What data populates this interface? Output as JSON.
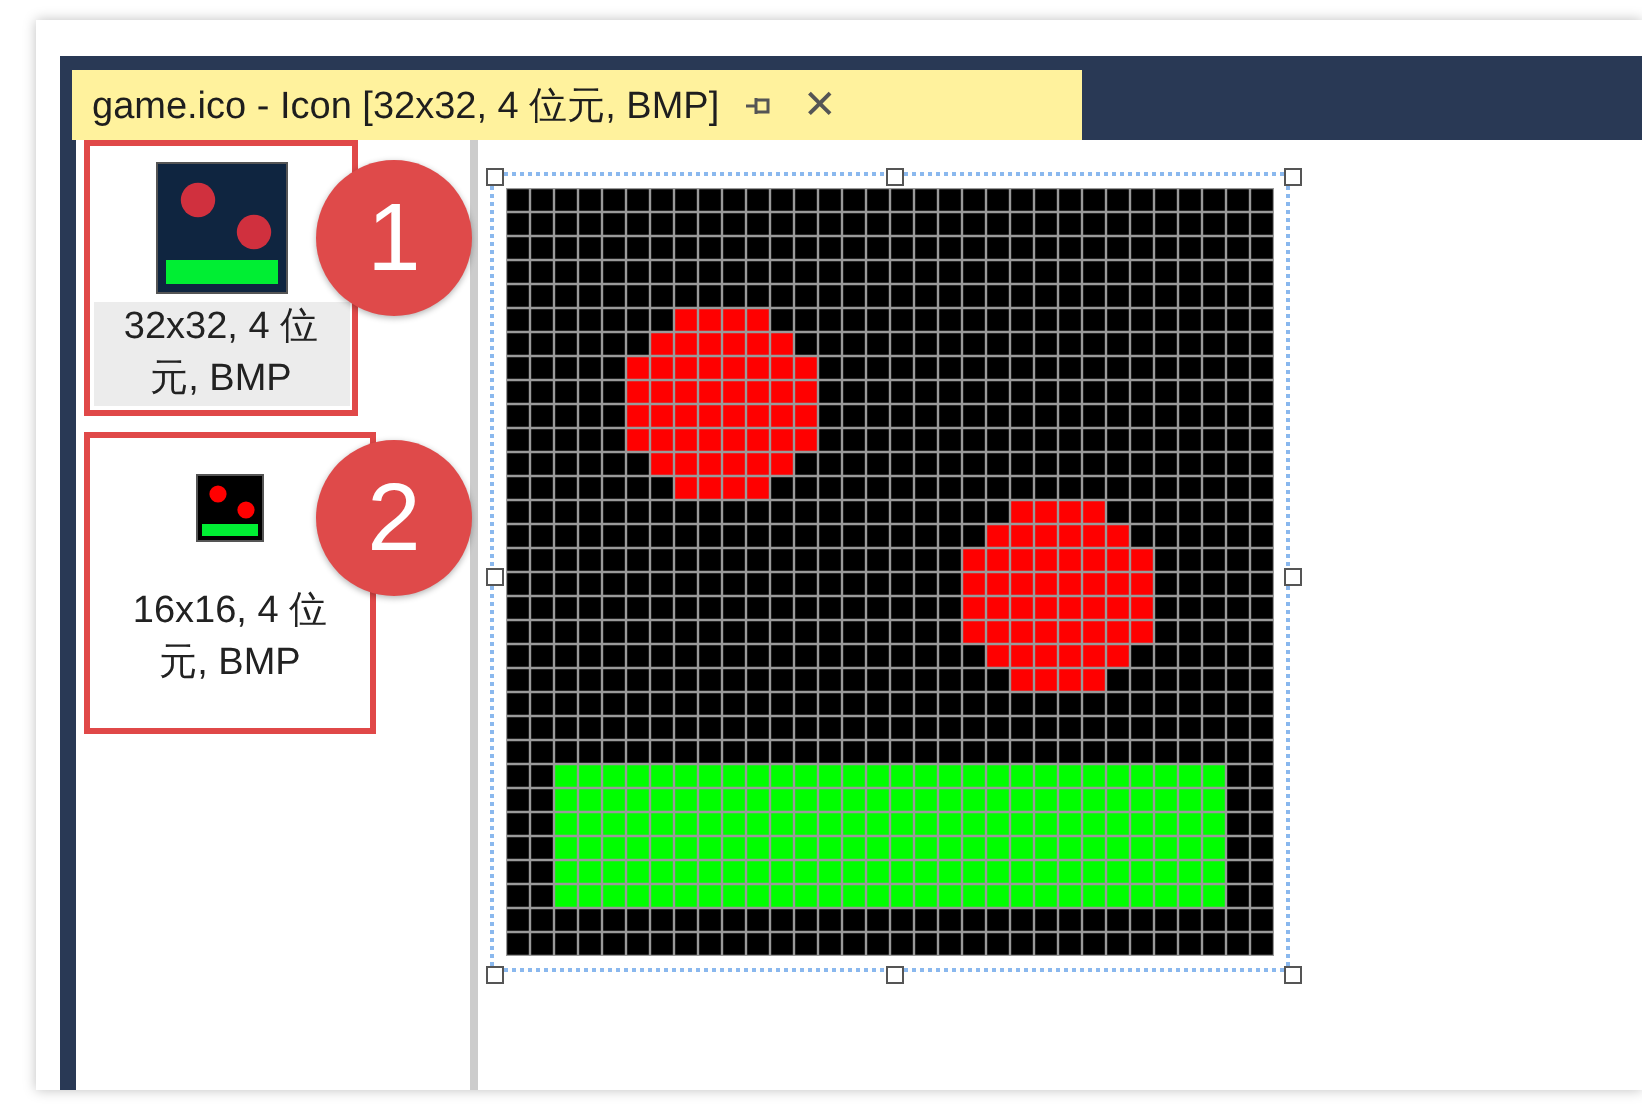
{
  "tab": {
    "title": "game.ico - Icon [32x32, 4 位元, BMP]",
    "close": "✕"
  },
  "images": [
    {
      "label": "32x32, 4 位元, BMP",
      "kind": "large",
      "selected": true,
      "callout": "1"
    },
    {
      "label": "16x16, 4 位元, BMP",
      "kind": "small",
      "selected": false,
      "callout": "2"
    }
  ]
}
